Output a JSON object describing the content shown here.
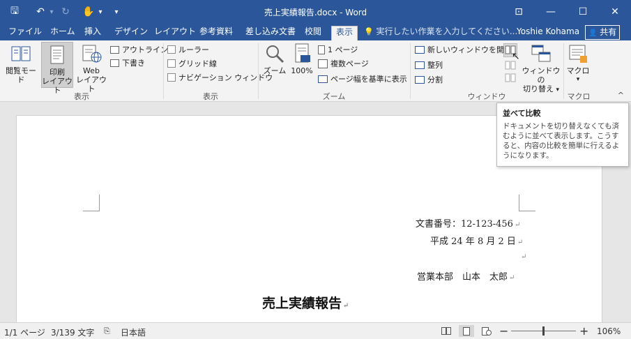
{
  "title_bar": {
    "title": "売上実績報告.docx - Word",
    "qat": {
      "save": "🖫",
      "undo": "↶",
      "undo_drop": "▾",
      "redo": "↻",
      "touch": "✋",
      "touch_drop": "▾",
      "customize": "▾"
    },
    "window": {
      "ribbon_display": "⊡",
      "minimize": "—",
      "maximize": "☐",
      "close": "✕"
    }
  },
  "tabs": [
    {
      "label": "ファイル",
      "active": false
    },
    {
      "label": "ホーム",
      "active": false
    },
    {
      "label": "挿入",
      "active": false
    },
    {
      "label": "デザイン",
      "active": false
    },
    {
      "label": "レイアウト",
      "active": false
    },
    {
      "label": "参考資料",
      "active": false
    },
    {
      "label": "差し込み文書",
      "active": false
    },
    {
      "label": "校閲",
      "active": false
    },
    {
      "label": "表示",
      "active": true
    }
  ],
  "tell_me": {
    "icon": "💡",
    "text": "実行したい作業を入力してください..."
  },
  "user": "Yoshie Kohama",
  "share": {
    "icon": "👤",
    "label": "共有"
  },
  "ribbon": {
    "views": {
      "group_label": "表示",
      "read_mode": "閲覧モード",
      "print_layout_1": "印刷",
      "print_layout_2": "レイアウト",
      "web_layout_1": "Web",
      "web_layout_2": "レイアウト",
      "outline": "アウトライン",
      "draft": "下書き"
    },
    "show": {
      "group_label": "表示",
      "ruler": "ルーラー",
      "gridlines": "グリッド線",
      "nav_pane": "ナビゲーション ウィンドウ"
    },
    "zoom": {
      "group_label": "ズーム",
      "zoom": "ズーム",
      "hundred": "100%",
      "one_page": "1 ページ",
      "multi_page": "複数ページ",
      "page_width": "ページ幅を基準に表示",
      "badge": "100"
    },
    "window": {
      "group_label": "ウィンドウ",
      "new_window": "新しいウィンドウを開く",
      "arrange_all": "整列",
      "split": "分割",
      "switch_1": "ウィンドウの",
      "switch_2": "切り替え",
      "switch_drop": "▾"
    },
    "macros": {
      "group_label": "マクロ",
      "label": "マクロ",
      "drop": "▾"
    },
    "collapse": "^"
  },
  "tooltip": {
    "title": "並べて比較",
    "body": "ドキュメントを切り替えなくても済むように並べて表示します。こうすると、内容の比較を簡単に行えるようになります。"
  },
  "document": {
    "doc_number": "文書番号：12-123-456",
    "date": "平成 24 年 8 月 2 日",
    "author": "営業本部　山本　太郎",
    "title": "売上実績報告",
    "para_mark": "↵"
  },
  "status_bar": {
    "page": "1/1 ページ",
    "words": "3/139 文字",
    "proof_icon": "⎘",
    "language": "日本語",
    "zoom_minus": "−",
    "zoom_plus": "+",
    "zoom_level": "106%",
    "zoom_fraction": 0.52
  }
}
